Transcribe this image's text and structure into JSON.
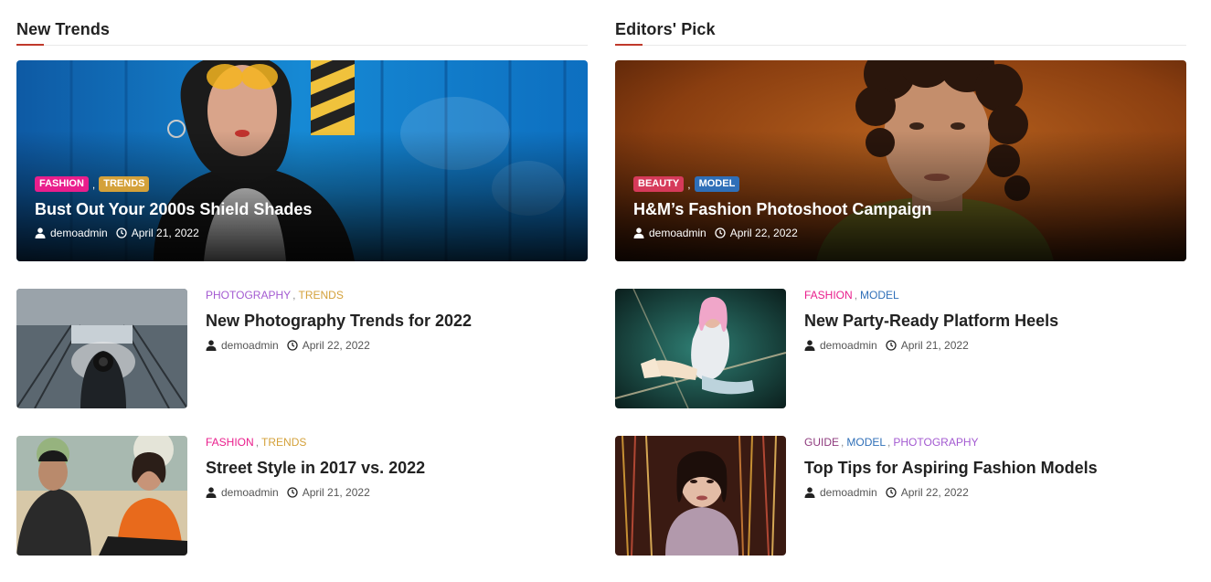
{
  "sections": [
    {
      "title": "New Trends",
      "feature": {
        "categories": [
          {
            "label": "FASHION",
            "color": "#e91e8c"
          },
          {
            "label": "TRENDS",
            "color": "#d4a13a"
          }
        ],
        "title": "Bust Out Your 2000s Shield Shades",
        "author": "demoadmin",
        "date": "April 21, 2022",
        "image": "photo-woman-yellow-sunglasses-blue-wall"
      },
      "items": [
        {
          "categories": [
            {
              "label": "PHOTOGRAPHY",
              "color": "#a35ad1"
            },
            {
              "label": "TRENDS",
              "color": "#d4a13a"
            }
          ],
          "title": "New Photography Trends for 2022",
          "author": "demoadmin",
          "date": "April 22, 2022",
          "image": "photo-photographer-escalator"
        },
        {
          "categories": [
            {
              "label": "FASHION",
              "color": "#e91e8c"
            },
            {
              "label": "TRENDS",
              "color": "#d4a13a"
            }
          ],
          "title": "Street Style in 2017 vs. 2022",
          "author": "demoadmin",
          "date": "April 21, 2022",
          "image": "photo-couple-street-style"
        }
      ]
    },
    {
      "title": "Editors' Pick",
      "feature": {
        "categories": [
          {
            "label": "BEAUTY",
            "color": "#d63a5a"
          },
          {
            "label": "MODEL",
            "color": "#2f6fb8"
          }
        ],
        "title": "H&M’s Fashion Photoshoot Campaign",
        "author": "demoadmin",
        "date": "April 22, 2022",
        "image": "photo-man-curly-hair-orange"
      },
      "items": [
        {
          "categories": [
            {
              "label": "FASHION",
              "color": "#e91e8c"
            },
            {
              "label": "MODEL",
              "color": "#2f6fb8"
            }
          ],
          "title": "New Party-Ready Platform Heels",
          "author": "demoadmin",
          "date": "April 21, 2022",
          "image": "photo-pink-hair-platform-heels"
        },
        {
          "categories": [
            {
              "label": "GUIDE",
              "color": "#8e3a7d"
            },
            {
              "label": "MODEL",
              "color": "#2f6fb8"
            },
            {
              "label": "PHOTOGRAPHY",
              "color": "#a35ad1"
            }
          ],
          "title": "Top Tips for Aspiring Fashion Models",
          "author": "demoadmin",
          "date": "April 22, 2022",
          "image": "photo-model-gold-tinsel"
        }
      ]
    }
  ],
  "icons": {
    "author": "user-icon",
    "date": "clock-icon"
  },
  "colors": {
    "accent_underline": "#c0392b"
  }
}
